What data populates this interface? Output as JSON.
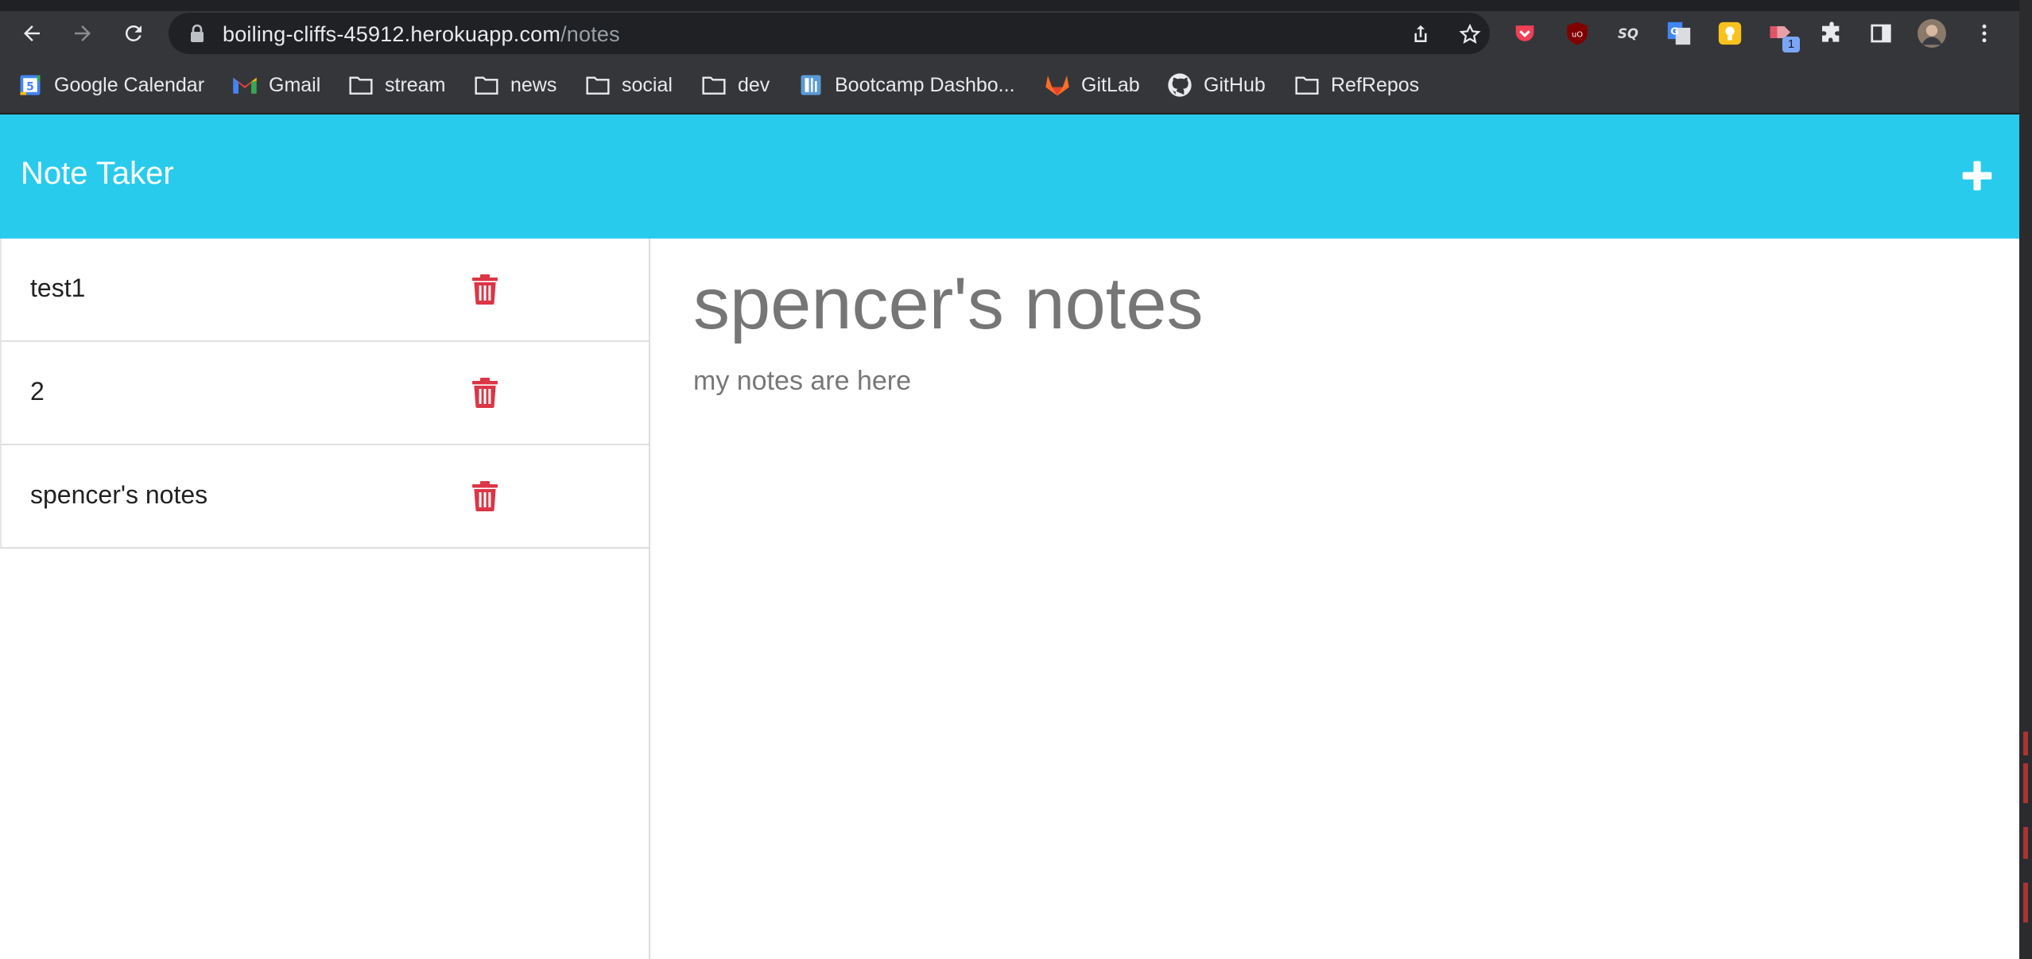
{
  "browser": {
    "url_host": "boiling-cliffs-45912.herokuapp.com",
    "url_path": "/notes",
    "extension_badge": "1",
    "bookmarks": [
      {
        "label": "Google Calendar",
        "icon": "google-calendar-icon"
      },
      {
        "label": "Gmail",
        "icon": "gmail-icon"
      },
      {
        "label": "stream",
        "icon": "folder-icon"
      },
      {
        "label": "news",
        "icon": "folder-icon"
      },
      {
        "label": "social",
        "icon": "folder-icon"
      },
      {
        "label": "dev",
        "icon": "folder-icon"
      },
      {
        "label": "Bootcamp Dashbo...",
        "icon": "bootcamp-icon"
      },
      {
        "label": "GitLab",
        "icon": "gitlab-icon"
      },
      {
        "label": "GitHub",
        "icon": "github-icon"
      },
      {
        "label": "RefRepos",
        "icon": "folder-icon"
      }
    ]
  },
  "app": {
    "title": "Note Taker",
    "header_color": "#29cbed",
    "delete_color": "#dc3545",
    "notes": [
      {
        "title": "test1"
      },
      {
        "title": "2"
      },
      {
        "title": "spencer's notes"
      }
    ],
    "active_note": {
      "title": "spencer's notes",
      "text": "my notes are here"
    }
  }
}
